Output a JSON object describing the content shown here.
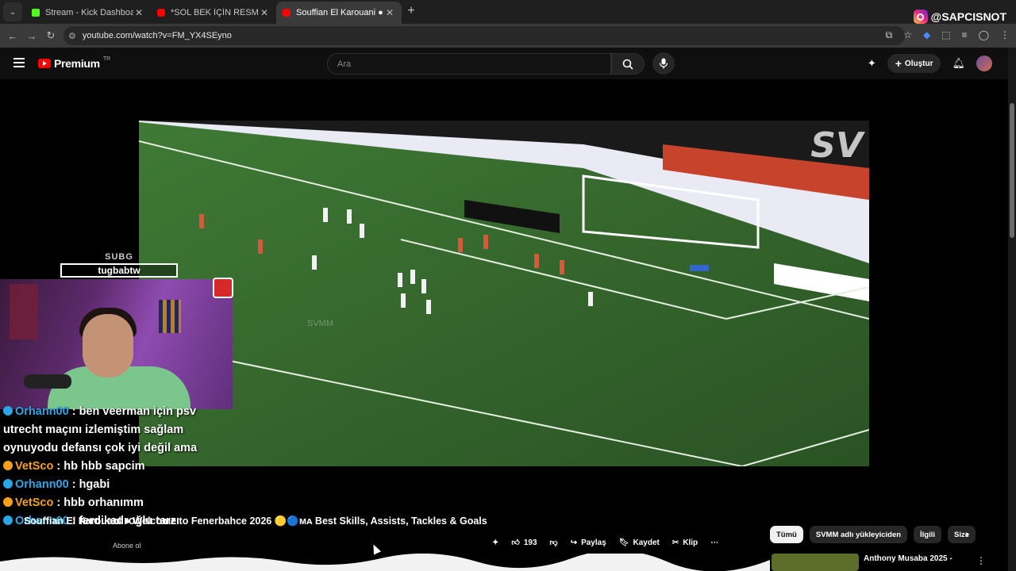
{
  "browser": {
    "tabs": [
      {
        "title": "Stream - Kick Dashboard",
        "favicon_color": "#53fc18",
        "active": false
      },
      {
        "title": "*SOL BEK İÇİN RESMİ TEKLİF YAPILDI*",
        "favicon_color": "#ff0000",
        "active": false
      },
      {
        "title": "Souffian El Karouani ● Welcome",
        "favicon_color": "#ff0000",
        "active": true
      }
    ],
    "url": "youtube.com/watch?v=FM_YX4SEyno",
    "new_tab_icon": "plus-icon"
  },
  "overlay": {
    "instagram_handle": "@SAPCISNOT",
    "sub_badge_top": "SUBG",
    "sub_badge_name": "tugbabtw"
  },
  "youtube": {
    "logo_text": "Premium",
    "region": "TR",
    "search_placeholder": "Ara",
    "create_label": "Oluştur"
  },
  "video": {
    "watermark": "SVMM",
    "corner_mark": "SV",
    "title": "Souffian El Karouani ● Welcome to Fenerbahce 2026 🟡🔵ᴍᴀ Best Skills, Assists, Tackles & Goals",
    "subscribe_label": "Abone ol",
    "like_count": "193",
    "share_label": "Paylaş",
    "save_label": "Kaydet",
    "clip_label": "Klip"
  },
  "chat": [
    {
      "user": "Orhann00",
      "message": ": ben veerman için psv utrecht maçını izlemiştim sağlam oynuyodu defansı çok iyi değil ama",
      "user_color": "#2aa7e8"
    },
    {
      "user": "VetSco",
      "message": ": hb hbb sapcim",
      "user_color": "#f4a11b"
    },
    {
      "user": "Orhann00",
      "message": ": hgabi",
      "user_color": "#2aa7e8"
    },
    {
      "user": "VetSco",
      "message": ": hbb orhanımm",
      "user_color": "#f4a11b"
    },
    {
      "user": "Orhann00",
      "message": ": ferdikadroğlu tarzı",
      "user_color": "#2aa7e8"
    }
  ],
  "recommendations": {
    "chips": [
      "Tümü",
      "SVMM adlı yükleyiciden",
      "İlgili",
      "Size"
    ],
    "first_title": "Anthony Musaba 2025 -"
  },
  "colors": {
    "accent": "#ff0000",
    "background": "#0f0f0f"
  }
}
